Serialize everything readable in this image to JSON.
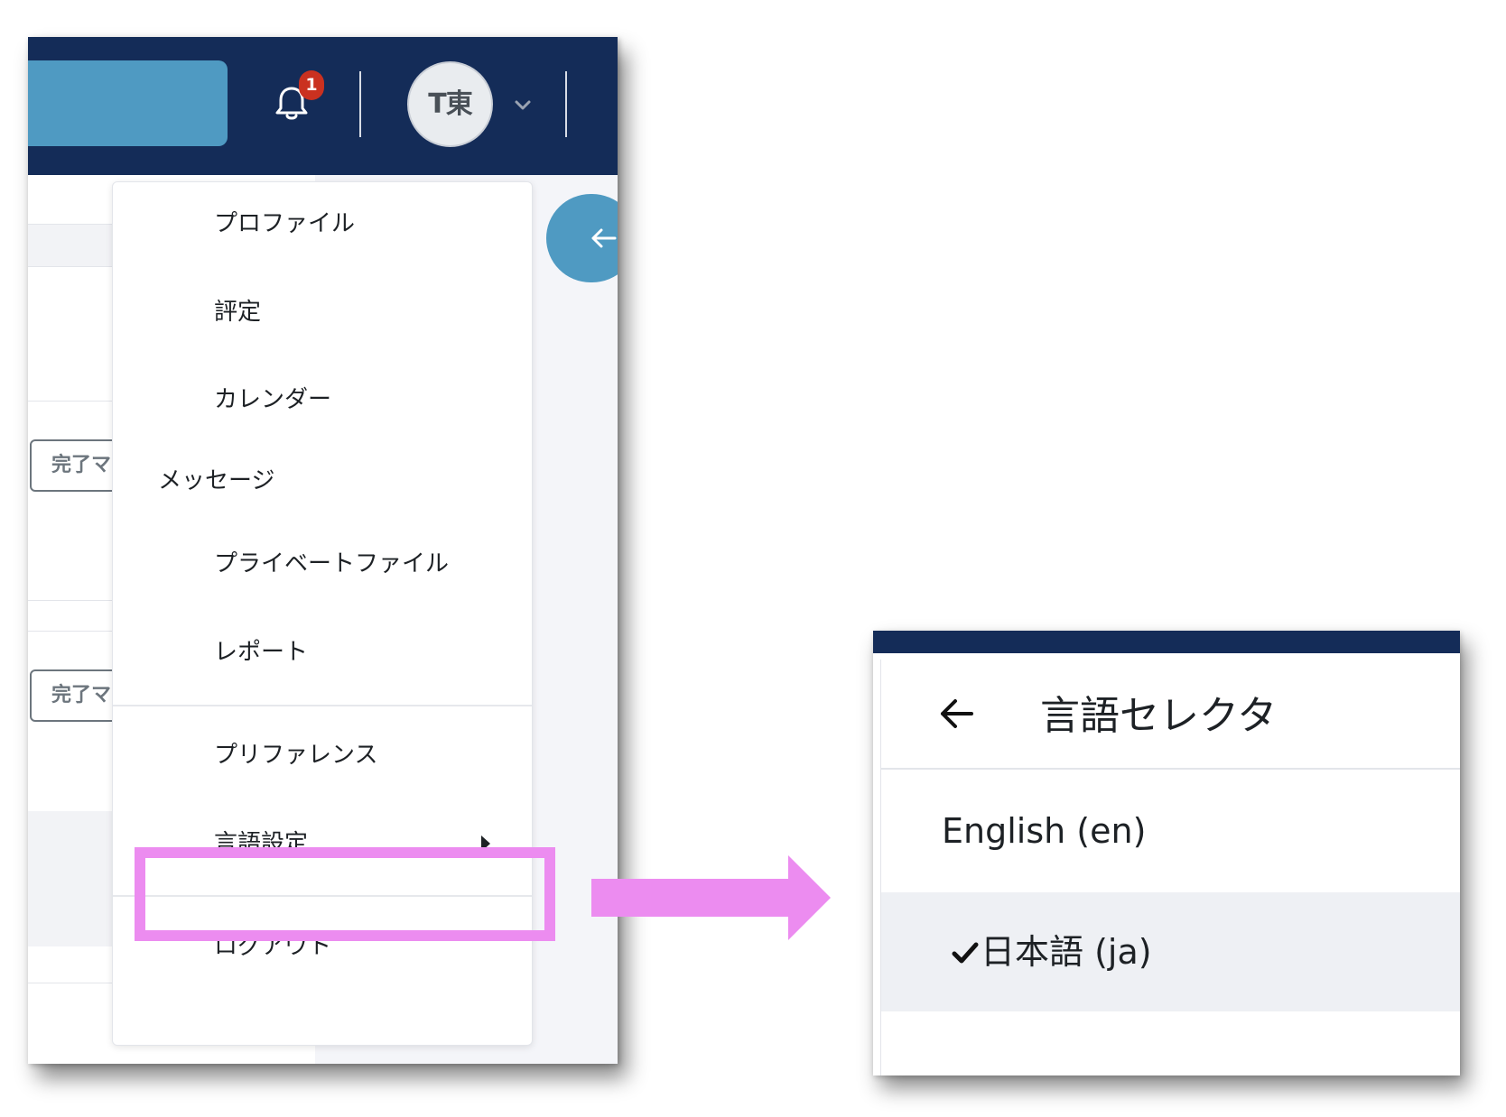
{
  "left_panel": {
    "notifications": {
      "count": "1"
    },
    "user": {
      "initials": "T東"
    },
    "row_buttons": [
      "完了マ",
      "完了マ"
    ],
    "dropdown": {
      "items": [
        {
          "label": "プロファイル"
        },
        {
          "label": "評定"
        },
        {
          "label": "カレンダー"
        },
        {
          "label": "メッセージ"
        },
        {
          "label": "プライベートファイル"
        },
        {
          "label": "レポート"
        },
        {
          "label": "プリファレンス"
        },
        {
          "label": "言語設定"
        },
        {
          "label": "ログアウト"
        }
      ]
    }
  },
  "right_panel": {
    "title": "言語セレクタ",
    "options": [
      {
        "label": "English (en)",
        "selected": false
      },
      {
        "label": "日本語 (ja)",
        "selected": true
      }
    ]
  },
  "colors": {
    "navbar": "#142c58",
    "accent": "#4f9ac2",
    "badge": "#ca3120",
    "highlight": "#ec8cf0"
  },
  "icons": [
    "bell-icon",
    "chevron-down-icon",
    "arrow-left-icon",
    "caret-right-icon",
    "checkmark-icon",
    "annotation-arrow"
  ]
}
